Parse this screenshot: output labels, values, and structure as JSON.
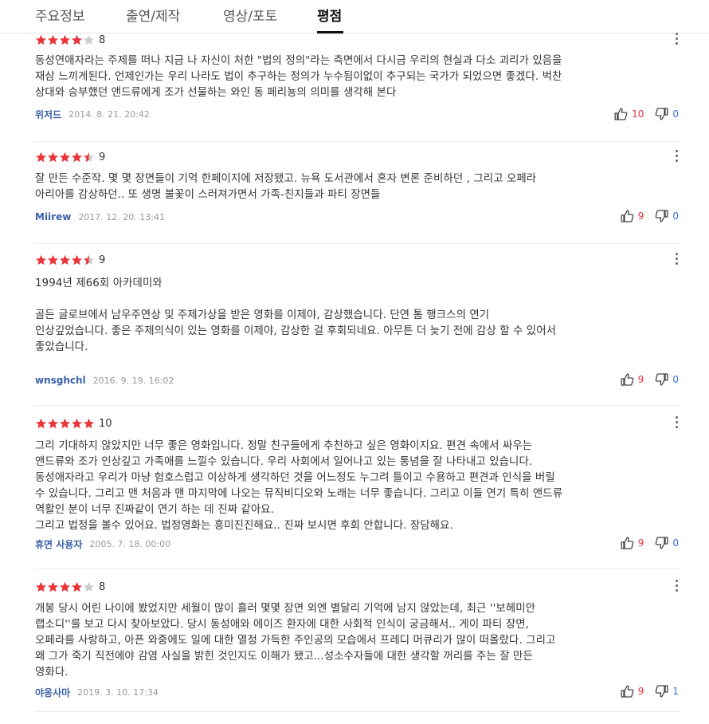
{
  "tabs": [
    {
      "label": "주요정보",
      "active": false
    },
    {
      "label": "출연/제작",
      "active": false
    },
    {
      "label": "영상/포토",
      "active": false
    },
    {
      "label": "평점",
      "active": true
    }
  ],
  "colors": {
    "star_filled": "#e8343a",
    "star_empty": "#cccccc",
    "author": "#3a5fa8",
    "like_count": "#e8343a",
    "dislike_count": "#3a6fd8"
  },
  "icons": {
    "star": "star-icon",
    "more": "more-vertical-icon",
    "like": "thumbs-up-icon",
    "dislike": "thumbs-down-icon"
  },
  "reviews": [
    {
      "rating": 8,
      "score": "8",
      "text": [
        "동성연애자라는 주제를 떠나 지금 나 자신이 처한 \"법의 정의\"라는 측면에서 다시금 우리의 현실과 다소 괴리가 있음을",
        "재삼 느끼게된다. 언제인가는 우리 나라도 법이 추구하는 정의가 누수됨이없이 추구되는 국가가 되었으면 좋겠다. 벅찬",
        "상대와 승부했던 앤드류에게 조가 선물하는 와인 동 페리뇽의 의미를 생각해 본다"
      ],
      "author": "위저드",
      "date": "2014. 8. 21. 20:42",
      "likes": "10",
      "dislikes": "0"
    },
    {
      "rating": 9,
      "score": "9",
      "text": [
        "잘 만든 수준작. 몇 몇 장면들이 기억 한페이지에 저장됐고. 뉴욕 도서관에서 혼자 변론 준비하던 , 그리고 오페라",
        "아리아를 감상하던.. 또 생명 불꽃이 스러져가면서 가족-친지들과  파티 장면들"
      ],
      "author": "Miirew",
      "date": "2017. 12. 20. 13:41",
      "likes": "9",
      "dislikes": "0"
    },
    {
      "rating": 9,
      "score": "9",
      "text": [
        " 1994년 제66회 아카데미와",
        "",
        "골든 글로브에서 남우주연상 및 주제가상을 받은 영화를 이제야, 감상했습니다. 단연 톰 행크스의 연기",
        "인상깊었습니다. 좋은 주제의식이 있는 영화를 이제야, 감상한 걸 후회되네요. 아무튼 더 늦기 전에 감상 할 수 있어서",
        "좋았습니다."
      ],
      "author": "wnsghchl",
      "date": "2016. 9. 19. 16:02",
      "likes": "9",
      "dislikes": "0"
    },
    {
      "rating": 10,
      "score": "10",
      "text": [
        "그리 기대하지 않았지만 너무 좋은 영화입니다. 정말 친구들에게 추천하고 싶은 영화이지요. 편견 속에서 싸우는",
        "앤드류와 조가 인상깊고 가족애를 느낄수 있습니다. 우리 사회에서 일어나고 있는 통념을 잘 나타내고 있습니다.",
        "동성애자라고 우리가 마냥 험호스럽고 이상하게 생각하던 것을 어느정도 누그려 틀이고 수용하고 편견과 인식을 버릴",
        "수 있습니다. 그리고 맨 처음과 맨 마지막에 나오는 뮤직비디오와 노래는 너무 좋습니다. 그리고 이들 연기 특히 앤드류",
        "역활인 분이 너무 진짜같이 연기 하는 데 진짜 같아요.",
        "그리고 법정을 볼수 있어요. 법정영화는 흥미진진해요.. 진짜 보시면 후회 안합니다. 장담해요."
      ],
      "author": "휴면 사용자",
      "date": "2005. 7. 18. 00:00",
      "likes": "9",
      "dislikes": "0"
    },
    {
      "rating": 8,
      "score": "8",
      "text": [
        "개봉 당시 어린 나이에 봤었지만 세월이 많이 흘러 몇몇 장면 외엔 별달리 기억에 남지 않았는데, 최근 ''보헤미안",
        "랩소디''를 보고 다시 찾아보았다. 당시 동성애와 에이즈 환자에 대한 사회적 인식이 궁금해서.. 게이 파티 장면,",
        "오페라를 사랑하고, 아픈 와중에도 일에 대한 열정 가득한 주인공의 모습에서 프레디 머큐리가 많이 떠올랐다. 그리고",
        "왜 그가 죽기 직전에야 감염 사실을 밝힌 것인지도 이해가 됐고...성소수자들에 대한 생각할 꺼리를 주는 잘 만든",
        "영화다."
      ],
      "author": "야옹사마",
      "date": "2019. 3. 10. 17:34",
      "likes": "9",
      "dislikes": "1"
    }
  ]
}
